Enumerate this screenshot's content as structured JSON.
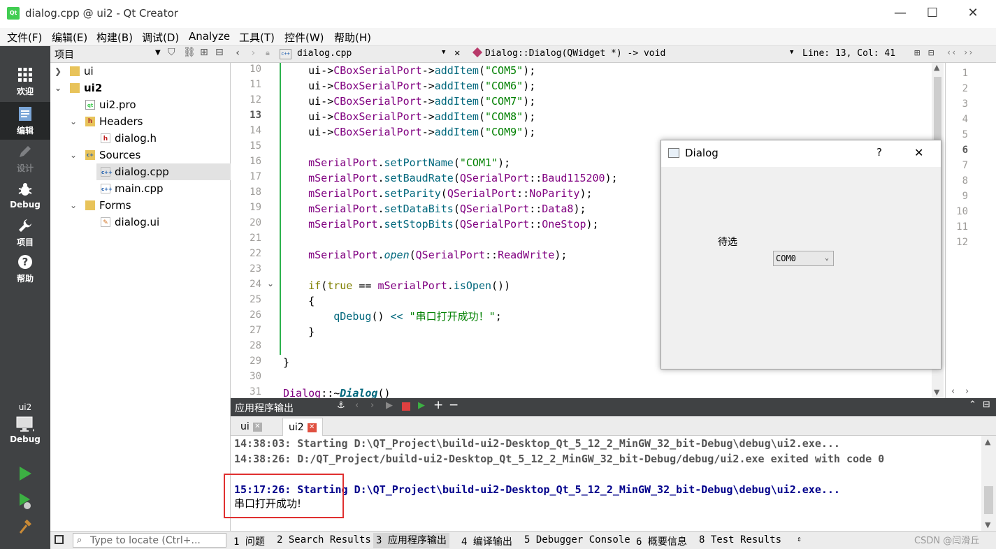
{
  "window": {
    "title": "dialog.cpp @ ui2 - Qt Creator",
    "app_icon": "Qt",
    "minimize": "—",
    "maximize": "☐",
    "close": "✕"
  },
  "menu": [
    "文件(F)",
    "编辑(E)",
    "构建(B)",
    "调试(D)",
    "Analyze",
    "工具(T)",
    "控件(W)",
    "帮助(H)"
  ],
  "modes": [
    {
      "label": "欢迎",
      "icon": "grid-icon"
    },
    {
      "label": "编辑",
      "icon": "edit-doc-icon"
    },
    {
      "label": "设计",
      "icon": "pencil-icon"
    },
    {
      "label": "Debug",
      "icon": "bug-icon"
    },
    {
      "label": "项目",
      "icon": "wrench-icon"
    },
    {
      "label": "帮助",
      "icon": "help-icon"
    }
  ],
  "kit": {
    "project": "ui2",
    "config": "Debug"
  },
  "project_panel": {
    "title": "项目",
    "tree": [
      {
        "label": "ui",
        "level": 0,
        "arrow": ">",
        "icon": "folder"
      },
      {
        "label": "ui2",
        "level": 0,
        "arrow": "v",
        "icon": "folder",
        "bold": true
      },
      {
        "label": "ui2.pro",
        "level": 1,
        "arrow": "",
        "icon": "pro"
      },
      {
        "label": "Headers",
        "level": 1,
        "arrow": "v",
        "icon": "hfolder"
      },
      {
        "label": "dialog.h",
        "level": 2,
        "arrow": "",
        "icon": "h"
      },
      {
        "label": "Sources",
        "level": 1,
        "arrow": "v",
        "icon": "cfolder"
      },
      {
        "label": "dialog.cpp",
        "level": 2,
        "arrow": "",
        "icon": "cpp",
        "selected": true
      },
      {
        "label": "main.cpp",
        "level": 2,
        "arrow": "",
        "icon": "cpp"
      },
      {
        "label": "Forms",
        "level": 1,
        "arrow": "v",
        "icon": "ffolder"
      },
      {
        "label": "dialog.ui",
        "level": 2,
        "arrow": "",
        "icon": "ui"
      }
    ]
  },
  "editor": {
    "file": "dialog.cpp",
    "symbol": "Dialog::Dialog(QWidget *) -> void",
    "position": "Line: 13, Col: 41",
    "current_line": 13,
    "line_numbers": [
      "10",
      "11",
      "12",
      "13",
      "14",
      "15",
      "16",
      "17",
      "18",
      "19",
      "20",
      "21",
      "22",
      "23",
      "24",
      "25",
      "26",
      "27",
      "28",
      "29",
      "30",
      "31"
    ],
    "lines": [
      "    ui->CBoxSerialPort->addItem(\"COM5\");",
      "    ui->CBoxSerialPort->addItem(\"COM6\");",
      "    ui->CBoxSerialPort->addItem(\"COM7\");",
      "    ui->CBoxSerialPort->addItem(\"COM8\");",
      "    ui->CBoxSerialPort->addItem(\"COM9\");",
      "",
      "    mSerialPort.setPortName(\"COM1\");",
      "    mSerialPort.setBaudRate(QSerialPort::Baud115200);",
      "    mSerialPort.setParity(QSerialPort::NoParity);",
      "    mSerialPort.setDataBits(QSerialPort::Data8);",
      "    mSerialPort.setStopBits(QSerialPort::OneStop);",
      "",
      "    mSerialPort.open(QSerialPort::ReadWrite);",
      "",
      "    if(true == mSerialPort.isOpen())",
      "    {",
      "        qDebug() << \"串口打开成功！\";",
      "    }",
      "",
      "}",
      "",
      "Dialog::~Dialog()"
    ],
    "right_line_numbers": [
      "1",
      "2",
      "3",
      "4",
      "5",
      "6",
      "7",
      "8",
      "9",
      "10",
      "11",
      "12"
    ],
    "right_current_line": 6
  },
  "dialog": {
    "title": "Dialog",
    "help": "?",
    "close": "✕",
    "label": "待选",
    "combo_value": "COM0"
  },
  "output": {
    "title": "应用程序输出",
    "tabs": [
      "ui",
      "ui2"
    ],
    "lines": [
      {
        "text": "14:38:03: Starting D:\\QT_Project\\build-ui2-Desktop_Qt_5_12_2_MinGW_32_bit-Debug\\debug\\ui2.exe...",
        "color": "#555555"
      },
      {
        "text": "14:38:26: D:/QT_Project/build-ui2-Desktop_Qt_5_12_2_MinGW_32_bit-Debug/debug/ui2.exe exited with code 0",
        "color": "#555555"
      },
      {
        "text": "",
        "color": "#000000"
      },
      {
        "text": "15:17:26: Starting D:\\QT_Project\\build-ui2-Desktop_Qt_5_12_2_MinGW_32_bit-Debug\\debug\\ui2.exe...",
        "color": "#00008b"
      },
      {
        "text": "串口打开成功!",
        "color": "#000000"
      }
    ]
  },
  "statusbar": {
    "locate_placeholder": "Type to locate (Ctrl+...",
    "panes": [
      "1 问题",
      "2 Search Results",
      "3 应用程序输出",
      "4 编译输出",
      "5 Debugger Console",
      "6 概要信息",
      "8 Test Results"
    ],
    "watermark": "CSDN @闫滑丘"
  },
  "colors": {
    "accent": "#41cd52",
    "sidebar": "#404244",
    "highlight_box": "#e03030"
  }
}
